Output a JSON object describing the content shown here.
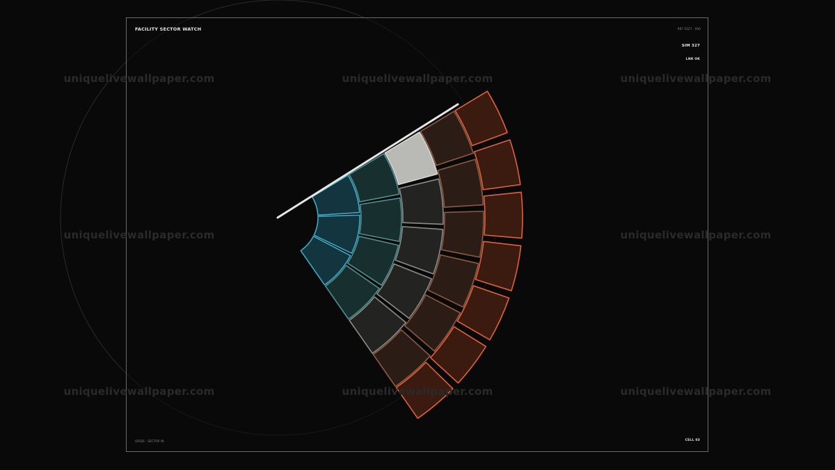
{
  "hud": {
    "title": "FACILITY SECTOR WATCH",
    "meta": "REF 0327 · 000",
    "sim_label": "SIM 327",
    "link_status": "LNK OK",
    "footer_left": "GRIDS · SECTOR IN",
    "footer_right": "CELL 03"
  },
  "watermark": {
    "text": "uniquelivewallpaper.com"
  },
  "colors": {
    "background": "#0a0909",
    "frame": "#6b6b6b",
    "teal": "#3fa9c4",
    "teal_fill": "#123540",
    "grey_fill": "#232321",
    "orange": "#e0623c",
    "orange_fill": "#3b1a10",
    "highlight": "#b9bab6",
    "sweep": "#e6e6e6"
  },
  "radar": {
    "rings": [
      {
        "name": "ring-1",
        "cells": 3,
        "style": "teal"
      },
      {
        "name": "ring-2",
        "cells": 4,
        "style": "teal-dark"
      },
      {
        "name": "ring-3",
        "cells": 5,
        "style": "grey",
        "highlight_index": 0
      },
      {
        "name": "ring-4",
        "cells": 6,
        "style": "brown"
      },
      {
        "name": "ring-5",
        "cells": 7,
        "style": "orange"
      }
    ]
  }
}
